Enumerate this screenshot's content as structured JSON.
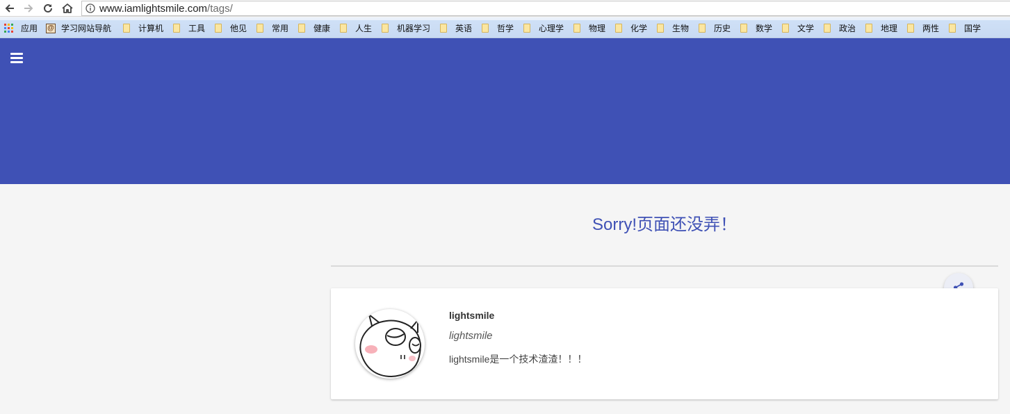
{
  "browser": {
    "url_host": "www.iamlightsmile.com",
    "url_path": "/tags/",
    "apps_label": "应用",
    "nav_site_label": "学习网站导航",
    "bookmarks": [
      "计算机",
      "工具",
      "他见",
      "常用",
      "健康",
      "人生",
      "机器学习",
      "英语",
      "哲学",
      "心理学",
      "物理",
      "化学",
      "生物",
      "历史",
      "数学",
      "文学",
      "政治",
      "地理",
      "两性",
      "国学"
    ]
  },
  "header": {
    "color": "#3f51b5"
  },
  "main": {
    "message": "Sorry!页面还没弄！"
  },
  "author_card": {
    "name": "lightsmile",
    "subtitle": "lightsmile",
    "bio": "lightsmile是一个技术渣渣！！！"
  },
  "icons": [
    "back-arrow-icon",
    "forward-arrow-icon",
    "reload-icon",
    "home-icon",
    "info-icon",
    "apps-grid-icon",
    "folder-icon",
    "menu-icon",
    "share-icon"
  ]
}
